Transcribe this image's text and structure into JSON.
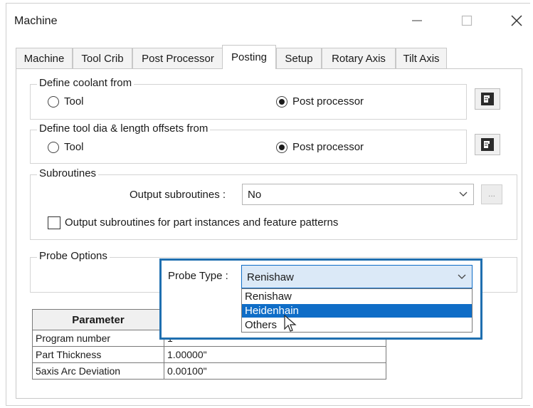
{
  "window": {
    "title": "Machine",
    "minimize_icon": "minimize-icon",
    "maximize_icon": "maximize-icon",
    "close_icon": "close-icon"
  },
  "tabs": [
    "Machine",
    "Tool Crib",
    "Post Processor",
    "Posting",
    "Setup",
    "Rotary Axis",
    "Tilt Axis"
  ],
  "active_tab": "Posting",
  "coolant": {
    "legend": "Define coolant from",
    "option_tool": "Tool",
    "option_post": "Post processor",
    "selected": "Post processor"
  },
  "offsets": {
    "legend": "Define tool dia & length offsets from",
    "option_tool": "Tool",
    "option_post": "Post processor",
    "selected": "Post processor"
  },
  "subroutines": {
    "legend": "Subroutines",
    "output_label": "Output subroutines :",
    "output_value": "No",
    "browse_label": "...",
    "checkbox_label": "Output subroutines for part instances and feature patterns",
    "checkbox_checked": false
  },
  "probe": {
    "legend": "Probe Options",
    "type_label": "Probe Type :",
    "type_value": "Renishaw",
    "options": [
      "Renishaw",
      "Heidenhain",
      "Others"
    ],
    "highlighted": "Heidenhain"
  },
  "parameters": {
    "header": "Parameter",
    "rows": [
      {
        "name": "Program number",
        "value": "1"
      },
      {
        "name": "Part Thickness",
        "value": "1.00000\""
      },
      {
        "name": "5axis Arc Deviation",
        "value": "0.00100\""
      }
    ]
  },
  "colors": {
    "highlight_box": "#1f6fb0",
    "selection": "#0f6dc7"
  }
}
